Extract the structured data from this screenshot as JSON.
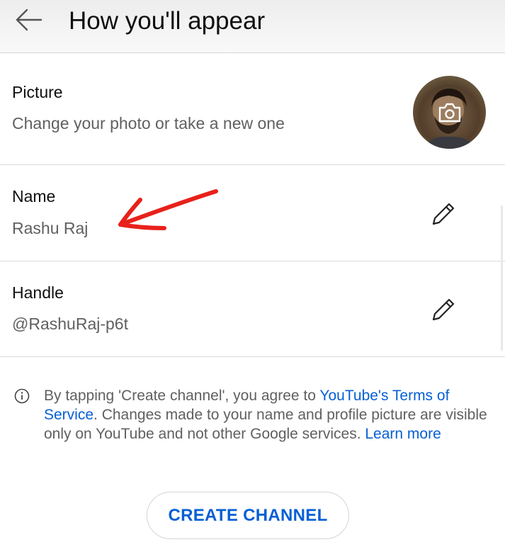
{
  "header": {
    "title": "How you'll appear",
    "back_icon": "arrow-left-icon"
  },
  "picture_row": {
    "label": "Picture",
    "description": "Change your photo or take a new one",
    "avatar_icon": "camera-icon"
  },
  "name_row": {
    "label": "Name",
    "value": "Rashu Raj",
    "edit_icon": "pencil-icon"
  },
  "handle_row": {
    "label": "Handle",
    "value": "@RashuRaj-p6t",
    "edit_icon": "pencil-icon"
  },
  "notice": {
    "text_1": "By tapping 'Create channel', you agree to ",
    "terms_link": "YouTube's Terms of Service",
    "text_2": ". Changes made to your name and profile picture are visible only on YouTube and not other Google services. ",
    "learn_more_link": "Learn more",
    "icon": "info-icon"
  },
  "create_button": {
    "label": "CREATE CHANNEL"
  },
  "colors": {
    "link": "#065fd4",
    "secondary_text": "#606060",
    "annotation_arrow": "#e8211a"
  }
}
